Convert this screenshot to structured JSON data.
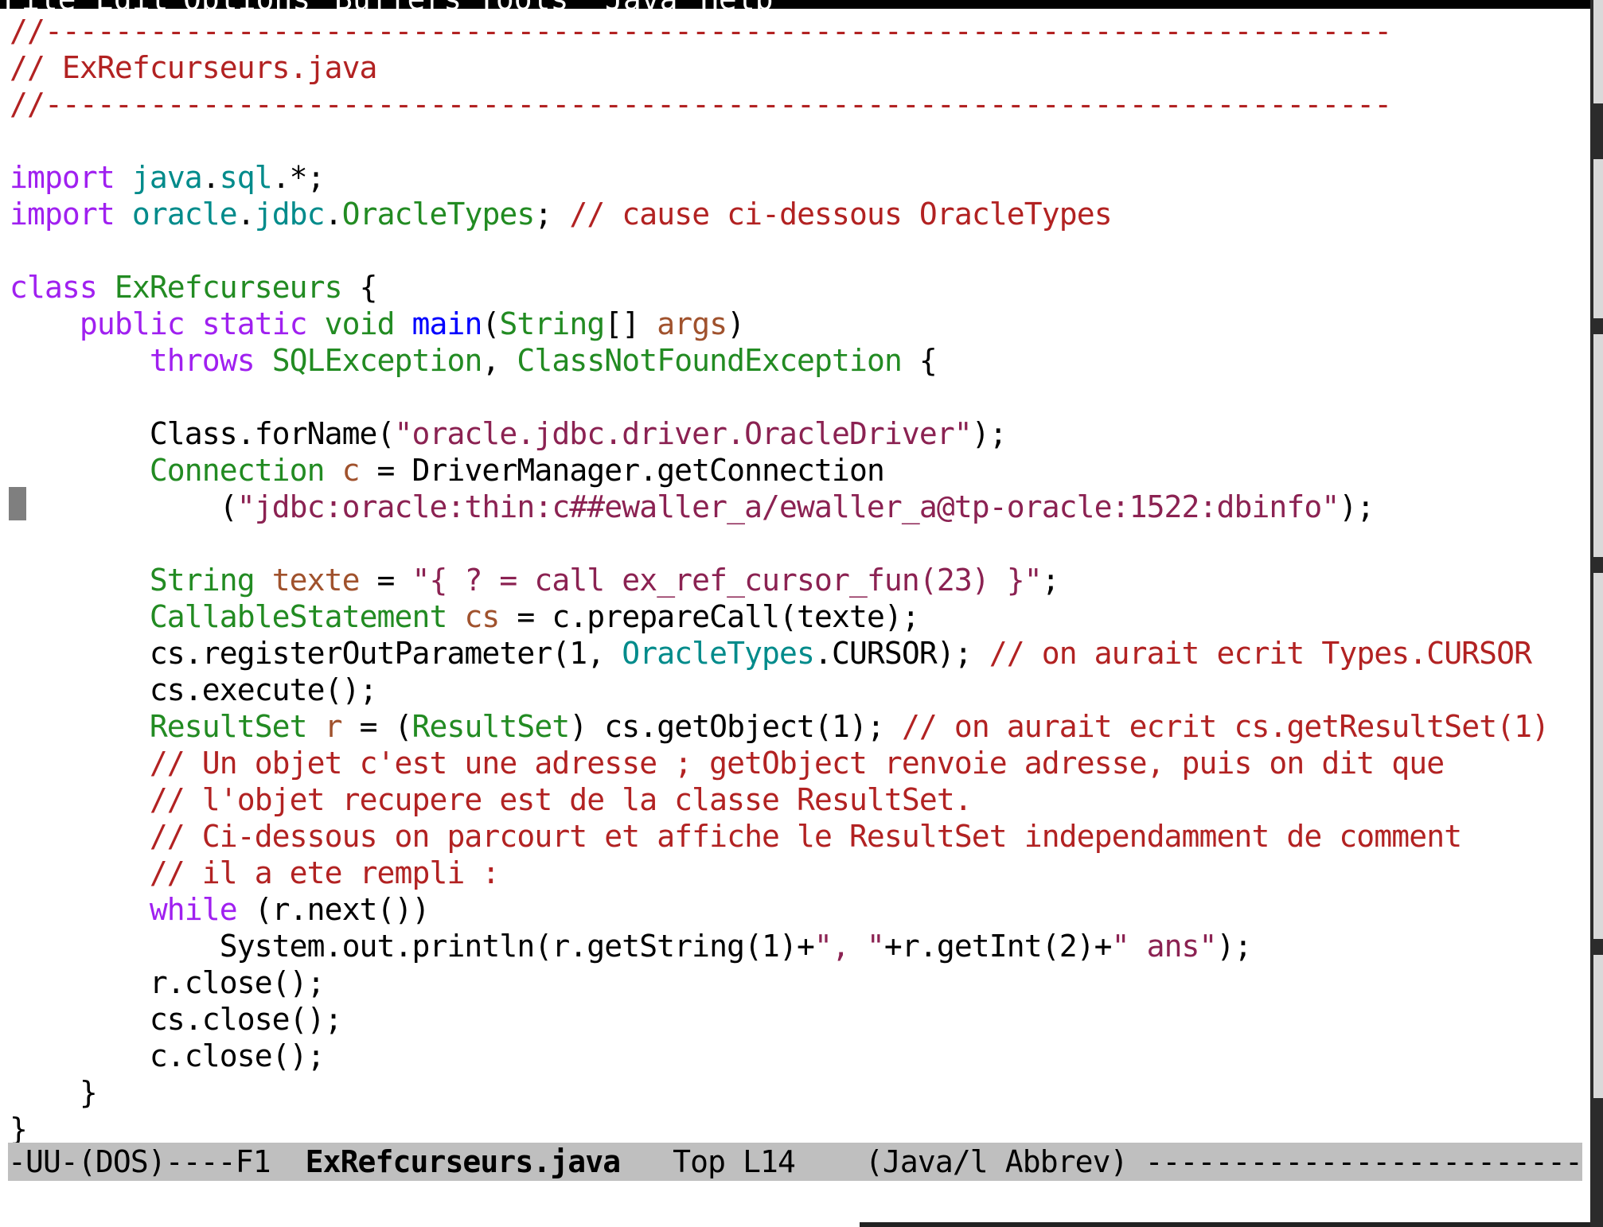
{
  "menubar": {
    "items": [
      "File",
      "Edit",
      "Options",
      "Buffers",
      "Tools",
      "Java",
      "Help"
    ]
  },
  "editor": {
    "filename": "ExRefcurseurs.java",
    "lines": [
      [
        {
          "t": "//-----------------------------------------------------------------------------",
          "c": "cm"
        }
      ],
      [
        {
          "t": "// ExRefcurseurs.java",
          "c": "cm"
        }
      ],
      [
        {
          "t": "//-----------------------------------------------------------------------------",
          "c": "cm"
        }
      ],
      [],
      [
        {
          "t": "import",
          "c": "kw"
        },
        {
          "t": " "
        },
        {
          "t": "java",
          "c": "cn"
        },
        {
          "t": "."
        },
        {
          "t": "sql",
          "c": "cn"
        },
        {
          "t": ".*;"
        }
      ],
      [
        {
          "t": "import",
          "c": "kw"
        },
        {
          "t": " "
        },
        {
          "t": "oracle",
          "c": "cn"
        },
        {
          "t": "."
        },
        {
          "t": "jdbc",
          "c": "cn"
        },
        {
          "t": "."
        },
        {
          "t": "OracleTypes",
          "c": "ty"
        },
        {
          "t": "; "
        },
        {
          "t": "// cause ci-dessous OracleTypes",
          "c": "cm"
        }
      ],
      [],
      [
        {
          "t": "class",
          "c": "kw"
        },
        {
          "t": " "
        },
        {
          "t": "ExRefcurseurs",
          "c": "ty"
        },
        {
          "t": " {"
        }
      ],
      [
        {
          "t": "    "
        },
        {
          "t": "public",
          "c": "kw"
        },
        {
          "t": " "
        },
        {
          "t": "static",
          "c": "kw"
        },
        {
          "t": " "
        },
        {
          "t": "void",
          "c": "ty"
        },
        {
          "t": " "
        },
        {
          "t": "main",
          "c": "fn"
        },
        {
          "t": "("
        },
        {
          "t": "String",
          "c": "ty"
        },
        {
          "t": "[] "
        },
        {
          "t": "args",
          "c": "va"
        },
        {
          "t": ")"
        }
      ],
      [
        {
          "t": "        "
        },
        {
          "t": "throws",
          "c": "kw"
        },
        {
          "t": " "
        },
        {
          "t": "SQLException",
          "c": "ty"
        },
        {
          "t": ", "
        },
        {
          "t": "ClassNotFoundException",
          "c": "ty"
        },
        {
          "t": " {"
        }
      ],
      [],
      [
        {
          "t": "        Class.forName("
        },
        {
          "t": "\"oracle.jdbc.driver.OracleDriver\"",
          "c": "st"
        },
        {
          "t": ");"
        }
      ],
      [
        {
          "t": "        "
        },
        {
          "t": "Connection",
          "c": "ty"
        },
        {
          "t": " "
        },
        {
          "t": "c",
          "c": "va"
        },
        {
          "t": " = DriverManager.getConnection"
        }
      ],
      [
        {
          "t": "            ("
        },
        {
          "t": "\"jdbc:oracle:thin:c##ewaller_a/ewaller_a@tp-oracle:1522:dbinfo\"",
          "c": "st"
        },
        {
          "t": ");"
        }
      ],
      [],
      [
        {
          "t": "        "
        },
        {
          "t": "String",
          "c": "ty"
        },
        {
          "t": " "
        },
        {
          "t": "texte",
          "c": "va"
        },
        {
          "t": " = "
        },
        {
          "t": "\"{ ? = call ex_ref_cursor_fun(23) }\"",
          "c": "st"
        },
        {
          "t": ";"
        }
      ],
      [
        {
          "t": "        "
        },
        {
          "t": "CallableStatement",
          "c": "ty"
        },
        {
          "t": " "
        },
        {
          "t": "cs",
          "c": "va"
        },
        {
          "t": " = c.prepareCall(texte);"
        }
      ],
      [
        {
          "t": "        cs.registerOutParameter(1, "
        },
        {
          "t": "OracleTypes",
          "c": "cn"
        },
        {
          "t": ".CURSOR); "
        },
        {
          "t": "// on aurait ecrit Types.CURSOR",
          "c": "cm"
        }
      ],
      [
        {
          "t": "        cs.execute();"
        }
      ],
      [
        {
          "t": "        "
        },
        {
          "t": "ResultSet",
          "c": "ty"
        },
        {
          "t": " "
        },
        {
          "t": "r",
          "c": "va"
        },
        {
          "t": " = ("
        },
        {
          "t": "ResultSet",
          "c": "ty"
        },
        {
          "t": ") cs.getObject(1); "
        },
        {
          "t": "// on aurait ecrit cs.getResultSet(1)",
          "c": "cm"
        }
      ],
      [
        {
          "t": "        "
        },
        {
          "t": "// Un objet c'est une adresse ; getObject renvoie adresse, puis on dit que",
          "c": "cm"
        }
      ],
      [
        {
          "t": "        "
        },
        {
          "t": "// l'objet recupere est de la classe ResultSet.",
          "c": "cm"
        }
      ],
      [
        {
          "t": "        "
        },
        {
          "t": "// Ci-dessous on parcourt et affiche le ResultSet independamment de comment",
          "c": "cm"
        }
      ],
      [
        {
          "t": "        "
        },
        {
          "t": "// il a ete rempli :",
          "c": "cm"
        }
      ],
      [
        {
          "t": "        "
        },
        {
          "t": "while",
          "c": "kw"
        },
        {
          "t": " (r.next())"
        }
      ],
      [
        {
          "t": "            System.out.println(r.getString(1)+"
        },
        {
          "t": "\", \"",
          "c": "st"
        },
        {
          "t": "+r.getInt(2)+"
        },
        {
          "t": "\" ans\"",
          "c": "st"
        },
        {
          "t": ");"
        }
      ],
      [
        {
          "t": "        r.close();"
        }
      ],
      [
        {
          "t": "        cs.close();"
        }
      ],
      [
        {
          "t": "        c.close();"
        }
      ],
      [
        {
          "t": "    }"
        }
      ],
      [
        {
          "t": "}"
        }
      ]
    ]
  },
  "modeline": {
    "prefix": "-UU-(DOS)----F1  ",
    "buffer_name": "ExRefcurseurs.java",
    "position": "   Top L14    (Java/l Abbrev) ",
    "fill": "-------------------------"
  },
  "colors": {
    "keyword": "#a020f0",
    "type": "#228b22",
    "variable": "#a0522d",
    "function": "#0000ff",
    "string": "#8b2252",
    "comment": "#b22222",
    "constant": "#008b8b",
    "modeline_bg": "#bfbfbf",
    "menubar_bg": "#000000"
  }
}
